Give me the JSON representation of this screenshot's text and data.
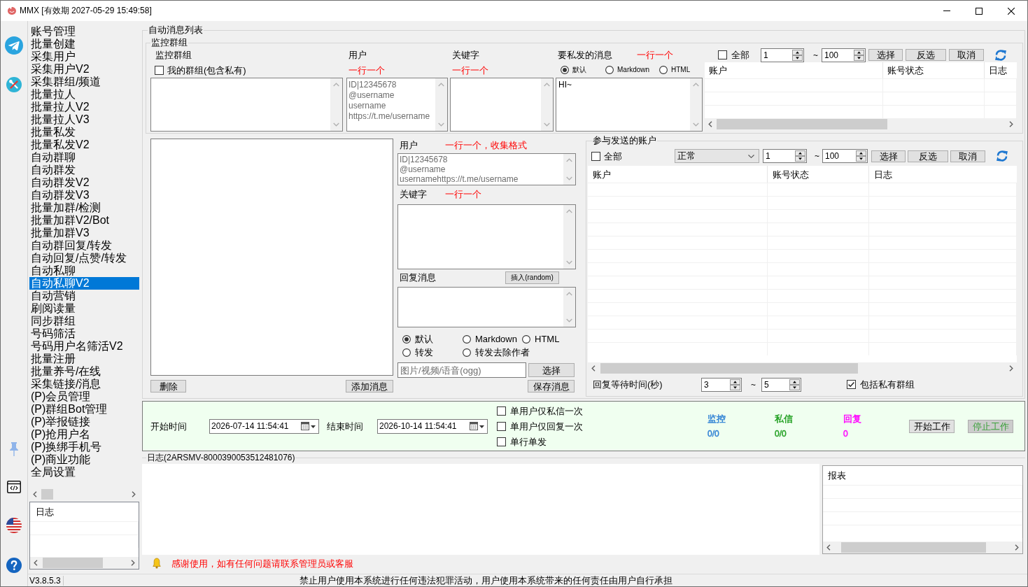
{
  "window": {
    "title": "MMX [有效期 2027-05-29 15:49:58]"
  },
  "sidebar": {
    "items": [
      {
        "label": "账号管理",
        "selected": false
      },
      {
        "label": "批量创建",
        "selected": false
      },
      {
        "label": "采集用户",
        "selected": false
      },
      {
        "label": "采集用户V2",
        "selected": false
      },
      {
        "label": "采集群组/频道",
        "selected": false
      },
      {
        "label": "批量拉人",
        "selected": false
      },
      {
        "label": "批量拉人V2",
        "selected": false
      },
      {
        "label": "批量拉人V3",
        "selected": false
      },
      {
        "label": "批量私发",
        "selected": false
      },
      {
        "label": "批量私发V2",
        "selected": false
      },
      {
        "label": "自动群聊",
        "selected": false
      },
      {
        "label": "自动群发",
        "selected": false
      },
      {
        "label": "自动群发V2",
        "selected": false
      },
      {
        "label": "自动群发V3",
        "selected": false
      },
      {
        "label": "批量加群/检测",
        "selected": false
      },
      {
        "label": "批量加群V2/Bot",
        "selected": false
      },
      {
        "label": "批量加群V3",
        "selected": false
      },
      {
        "label": "自动群回复/转发",
        "selected": false
      },
      {
        "label": "自动回复/点赞/转发",
        "selected": false
      },
      {
        "label": "自动私聊",
        "selected": false
      },
      {
        "label": "自动私聊V2",
        "selected": true
      },
      {
        "label": "自动营销",
        "selected": false
      },
      {
        "label": "刷阅读量",
        "selected": false
      },
      {
        "label": "同步群组",
        "selected": false
      },
      {
        "label": "号码筛活",
        "selected": false
      },
      {
        "label": "号码用户名筛活V2",
        "selected": false
      },
      {
        "label": "批量注册",
        "selected": false
      },
      {
        "label": "批量养号/在线",
        "selected": false
      },
      {
        "label": "采集链接/消息",
        "selected": false
      },
      {
        "label": "(P)会员管理",
        "selected": false
      },
      {
        "label": "(P)群组Bot管理",
        "selected": false
      },
      {
        "label": "(P)举报链接",
        "selected": false
      },
      {
        "label": "(P)抢用户名",
        "selected": false
      },
      {
        "label": "(P)换绑手机号",
        "selected": false
      },
      {
        "label": "(P)商业功能",
        "selected": false
      },
      {
        "label": "全局设置",
        "selected": false
      }
    ],
    "log_list": {
      "header": "日志"
    }
  },
  "messages": {
    "title": "自动消息列表",
    "monitor": {
      "title": "监控群组",
      "groups": {
        "label": "监控群组",
        "my_groups": {
          "label": "我的群组(包含私有)",
          "checked": false
        }
      },
      "users": {
        "label": "用户",
        "hint": "一行一个",
        "placeholder": "ID|12345678\n@username\nusername\nhttps://t.me/username"
      },
      "keywords": {
        "label": "关键字",
        "hint": "一行一个"
      },
      "message": {
        "label": "要私发的消息",
        "hint": "一行一个",
        "formats": [
          {
            "label": "默认",
            "selected": true
          },
          {
            "label": "Markdown",
            "selected": false
          },
          {
            "label": "HTML",
            "selected": false
          }
        ],
        "value": "HI~"
      },
      "accounts": {
        "select_all": {
          "label": "全部",
          "checked": false
        },
        "range_from": "1",
        "range_separator": "~",
        "range_to": "100",
        "buttons": [
          "选择",
          "反选",
          "取消"
        ],
        "columns": [
          "账户",
          "账号状态",
          "日志"
        ]
      }
    },
    "message_list": {
      "buttons": [
        "删除",
        "添加消息"
      ]
    },
    "reply": {
      "users": {
        "label": "用户",
        "hint": "一行一个，收集格式",
        "placeholder": "ID|12345678\n@username\nusernamehttps://t.me/username"
      },
      "keywords": {
        "label": "关键字",
        "hint": "一行一个"
      },
      "reply_message": {
        "label": "回复消息",
        "insert_button": "插入(random)"
      },
      "modes": [
        {
          "label": "默认",
          "selected": true
        },
        {
          "label": "Markdown",
          "selected": false
        },
        {
          "label": "HTML",
          "selected": false
        },
        {
          "label": "转发",
          "selected": false
        },
        {
          "label": "转发去除作者",
          "selected": false
        }
      ],
      "media": {
        "placeholder": "图片/视频/语音(ogg)",
        "button": "选择"
      },
      "save_button": "保存消息"
    },
    "senders": {
      "title": "参与发送的账户",
      "select_all": {
        "label": "全部",
        "checked": false
      },
      "status_filter": "正常",
      "range_from": "1",
      "range_separator": "~",
      "range_to": "100",
      "buttons": [
        "选择",
        "反选",
        "取消"
      ],
      "columns": [
        "账户",
        "账号状态",
        "日志"
      ],
      "wait": {
        "label": "回复等待时间(秒)",
        "from": "3",
        "separator": "~",
        "to": "5"
      },
      "include_private": {
        "label": "包括私有群组",
        "checked": true
      }
    }
  },
  "schedule": {
    "start": {
      "label": "开始时间",
      "value": "2026-07-14 11:54:41"
    },
    "end": {
      "label": "结束时间",
      "value": "2026-10-14 11:54:41"
    },
    "options": [
      {
        "label": "单用户仅私信一次",
        "checked": false
      },
      {
        "label": "单用户仅回复一次",
        "checked": false
      },
      {
        "label": "单行单发",
        "checked": false
      }
    ],
    "stats": [
      {
        "label": "监控",
        "value": "0/0",
        "color": "#2b7fd4"
      },
      {
        "label": "私信",
        "value": "0/0",
        "color": "#22a022"
      },
      {
        "label": "回复",
        "value": "0",
        "color": "#ff00ff"
      }
    ],
    "buttons": [
      {
        "label": "开始工作",
        "disabled": false
      },
      {
        "label": "停止工作",
        "disabled": true
      }
    ]
  },
  "log": {
    "title": "日志(2ARSMV-8000390053512481076)",
    "report": {
      "header": "报表"
    }
  },
  "notice": "感谢使用，如有任何问题请联系管理员或客服",
  "status_bar": {
    "version": "V3.8.5.3",
    "disclaimer": "禁止用户使用本系统进行任何违法犯罪活动，用户使用本系统带来的任何责任由用户自行承担"
  }
}
